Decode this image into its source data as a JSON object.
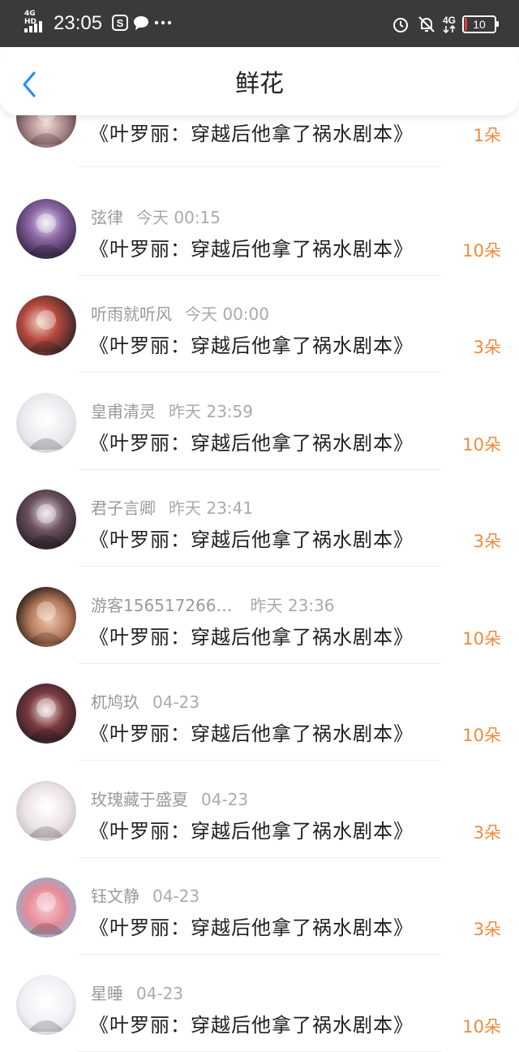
{
  "status_bar": {
    "network": "4G HD",
    "time": "23:05",
    "battery_level": "10",
    "battery_fraction": 0.1,
    "data_network": "4G",
    "icons": [
      "signal-icon",
      "s-app-icon",
      "chat-bubble-icon",
      "more-dots-icon",
      "alarm-icon",
      "mute-icon",
      "mobile-data-icon",
      "battery-icon"
    ]
  },
  "nav": {
    "back_icon": "chevron-left-icon",
    "title": "鲜花"
  },
  "colors": {
    "accent": "#2a8ef0",
    "count": "#f08a3c",
    "battery_low": "#e43b3b"
  },
  "items": [
    {
      "user": "",
      "time": "",
      "book": "《叶罗丽：穿越后他拿了祸水剧本》",
      "count": "1朵",
      "avatar": "avatar-partial"
    },
    {
      "user": "弦律",
      "time": "今天 00:15",
      "book": "《叶罗丽：穿越后他拿了祸水剧本》",
      "count": "10朵",
      "avatar": "avatar-anime-purple"
    },
    {
      "user": "听雨就听风",
      "time": "今天 00:00",
      "book": "《叶罗丽：穿越后他拿了祸水剧本》",
      "count": "3朵",
      "avatar": "avatar-anime-red"
    },
    {
      "user": "皇甫清灵",
      "time": "昨天 23:59",
      "book": "《叶罗丽：穿越后他拿了祸水剧本》",
      "count": "10朵",
      "avatar": "avatar-anime-white"
    },
    {
      "user": "君子言卿",
      "time": "昨天 23:41",
      "book": "《叶罗丽：穿越后他拿了祸水剧本》",
      "count": "3朵",
      "avatar": "avatar-anime-dark"
    },
    {
      "user": "游客156517266…",
      "time": "昨天 23:36",
      "book": "《叶罗丽：穿越后他拿了祸水剧本》",
      "count": "10朵",
      "avatar": "avatar-photo"
    },
    {
      "user": "杌鸠玖",
      "time": "04-23",
      "book": "《叶罗丽：穿越后他拿了祸水剧本》",
      "count": "10朵",
      "avatar": "avatar-anime-rose"
    },
    {
      "user": "玫瑰藏于盛夏",
      "time": "04-23",
      "book": "《叶罗丽：穿越后他拿了祸水剧本》",
      "count": "3朵",
      "avatar": "avatar-anime-pale"
    },
    {
      "user": "钰文静",
      "time": "04-23",
      "book": "《叶罗丽：穿越后他拿了祸水剧本》",
      "count": "3朵",
      "avatar": "avatar-blossom"
    },
    {
      "user": "星睡",
      "time": "04-23",
      "book": "《叶罗丽：穿越后他拿了祸水剧本》",
      "count": "10朵",
      "avatar": "avatar-sketch"
    }
  ]
}
